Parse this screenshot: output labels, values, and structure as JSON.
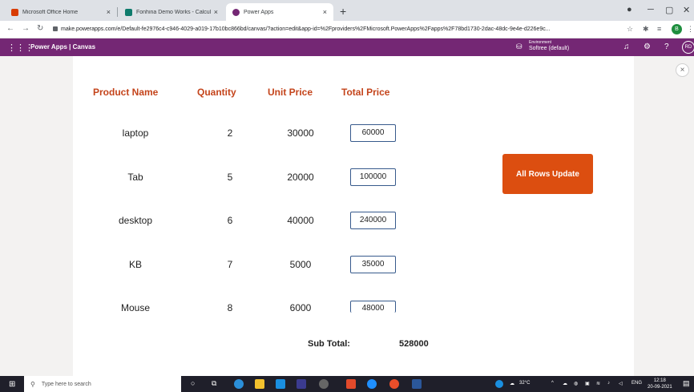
{
  "browser": {
    "tabs": [
      {
        "title": "Microsoft Office Home",
        "color": "#d83b01"
      },
      {
        "title": "Fonhina Demo Works - Calculati",
        "color": "#0f7b6c"
      },
      {
        "title": "Power Apps",
        "color": "#742774"
      }
    ],
    "new_tab": "+",
    "close": "×",
    "url": "make.powerapps.com/e/Default-fe2976c4-c946-4029-a019-17b10bc866bd/canvas/?action=edit&app-id=%2Fproviders%2FMicrosoft.PowerApps%2Fapps%2F78bd1730-2dac-48dc-9e4e-d226e9c...",
    "profile_initial": "B"
  },
  "powerapps": {
    "title": "Power Apps | Canvas",
    "environment_label": "Environment",
    "environment_value": "Softree (default)",
    "avatar": "RD"
  },
  "table": {
    "headers": {
      "product": "Product Name",
      "quantity": "Quantity",
      "unit_price": "Unit Price",
      "total_price": "Total Price"
    },
    "rows": [
      {
        "product": "laptop",
        "quantity": "2",
        "unit_price": "30000",
        "total_price": "60000"
      },
      {
        "product": "Tab",
        "quantity": "5",
        "unit_price": "20000",
        "total_price": "100000"
      },
      {
        "product": "desktop",
        "quantity": "6",
        "unit_price": "40000",
        "total_price": "240000"
      },
      {
        "product": "KB",
        "quantity": "7",
        "unit_price": "5000",
        "total_price": "35000"
      },
      {
        "product": "Mouse",
        "quantity": "8",
        "unit_price": "6000",
        "total_price": "48000"
      }
    ]
  },
  "update_button": "All Rows Update",
  "subtotal": {
    "label": "Sub Total:",
    "value": "528000"
  },
  "taskbar": {
    "search_placeholder": "Type here to search",
    "weather": "32°C",
    "language": "ENG",
    "time": "12:18",
    "date": "20-09-2021"
  }
}
